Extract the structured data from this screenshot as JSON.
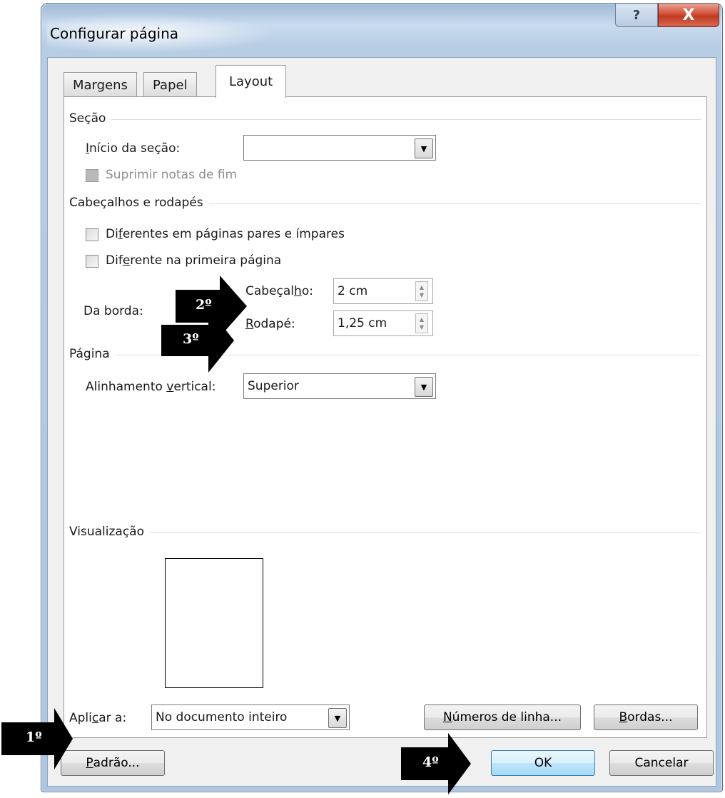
{
  "window": {
    "title": "Configurar página",
    "help_glyph": "?",
    "close_glyph": "X"
  },
  "tabs": [
    {
      "label": "Margens",
      "active": false
    },
    {
      "label": "Papel",
      "active": false
    },
    {
      "label": "Layout",
      "active": true
    }
  ],
  "secao": {
    "group_label": "Seção",
    "inicio_label_first": "I",
    "inicio_label_rest": "nício da seção:",
    "inicio_value": "",
    "suprimir_label": "Suprimir notas de fim"
  },
  "cabecalhos": {
    "group_label": "Cabeçalhos e rodapés",
    "pares_impares": {
      "pre": "Di",
      "u": "f",
      "post": "erentes em páginas pares e ímpares"
    },
    "primeira": {
      "pre": "Dif",
      "u": "e",
      "post": "rente na primeira página"
    },
    "da_borda_label": "Da borda:",
    "cabecalho": {
      "pre": "Cabeçal",
      "u": "h",
      "post": "o:",
      "value": "2 cm"
    },
    "rodape": {
      "u": "R",
      "post": "odapé:",
      "value": "1,25 cm"
    }
  },
  "pagina": {
    "group_label": "Página",
    "alinhamento": {
      "pre": "Alinhamento ",
      "u": "v",
      "post": "ertical:",
      "value": "Superior"
    }
  },
  "visualizacao": {
    "group_label": "Visualização",
    "aplicar": {
      "pre": "Apli",
      "u": "c",
      "post": "ar a:",
      "value": "No documento inteiro"
    },
    "numeros_button": {
      "u": "N",
      "post": "úmeros de linha..."
    },
    "bordas_button": {
      "u": "B",
      "post": "ordas..."
    }
  },
  "footer": {
    "padrao_button": {
      "u": "P",
      "post": "adrão..."
    },
    "ok_button": "OK",
    "cancel_button": "Cancelar"
  },
  "annotations": [
    {
      "label": "1º"
    },
    {
      "label": "2º"
    },
    {
      "label": "3º"
    },
    {
      "label": "4º"
    }
  ]
}
